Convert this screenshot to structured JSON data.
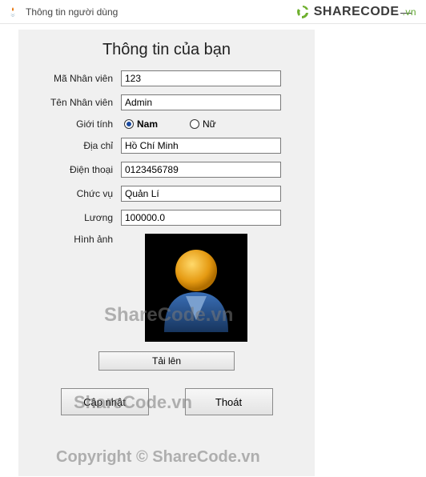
{
  "window": {
    "title": "Thông tin người dùng",
    "minimize": "—"
  },
  "logo": {
    "text": "SHARECODE",
    "suffix": ".vn"
  },
  "heading": "Thông tin của bạn",
  "labels": {
    "id": "Mã Nhân viên",
    "name": "Tên Nhân viên",
    "gender": "Giới tính",
    "address": "Địa chỉ",
    "phone": "Điện thoại",
    "role": "Chức vụ",
    "salary": "Lương",
    "image": "Hình ảnh"
  },
  "values": {
    "id": "123",
    "name": "Admin",
    "address": "Hồ Chí Minh",
    "phone": "0123456789",
    "role": "Quản Lí",
    "salary": "100000.0"
  },
  "gender": {
    "male": "Nam",
    "female": "Nữ",
    "selected": "male"
  },
  "buttons": {
    "upload": "Tải lên",
    "update": "Cập nhật",
    "exit": "Thoát"
  },
  "watermarks": {
    "w1": "ShareCode.vn",
    "w2": "ShareCode.vn",
    "w3": "Copyright © ShareCode.vn"
  }
}
